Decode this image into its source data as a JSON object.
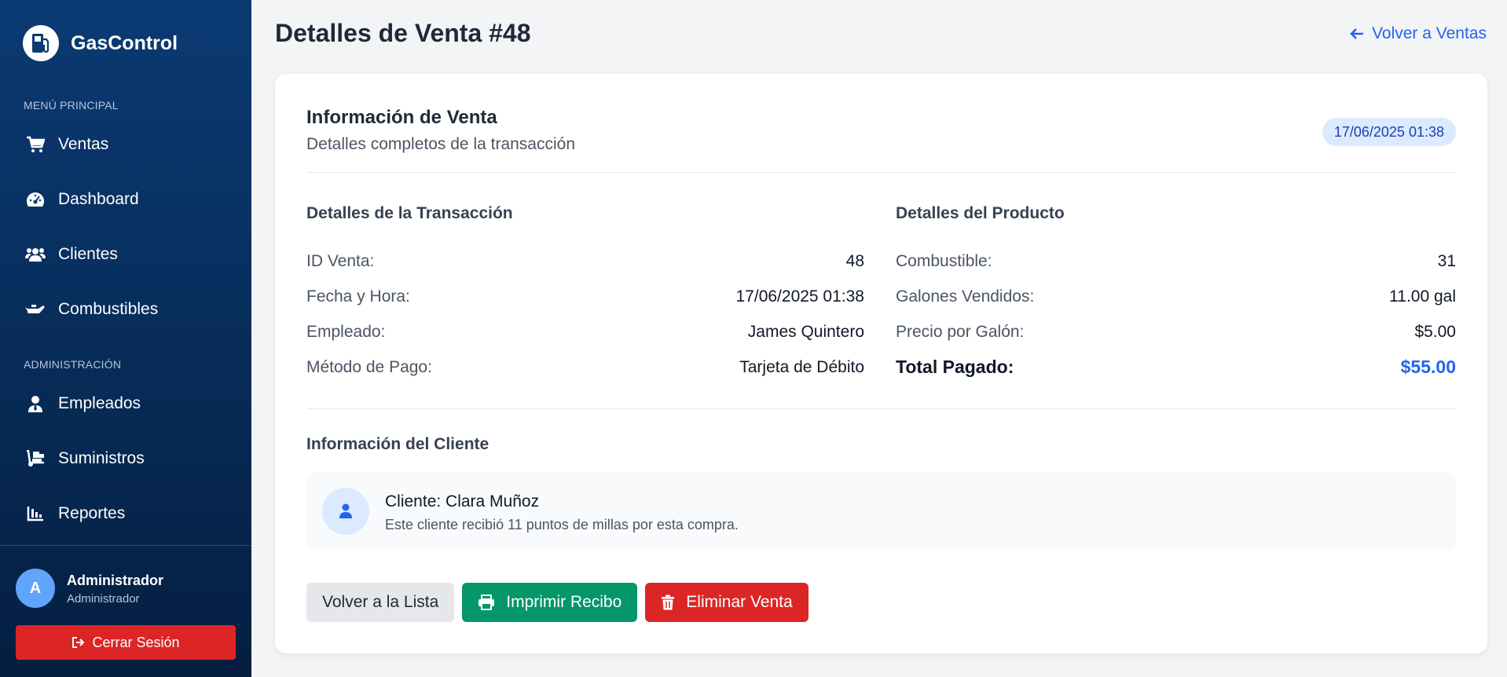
{
  "app": {
    "name": "GasControl"
  },
  "sidebar": {
    "main_menu_label": "MENÚ PRINCIPAL",
    "admin_label": "ADMINISTRACIÓN",
    "main_items": [
      {
        "label": "Ventas",
        "icon": "cart-icon"
      },
      {
        "label": "Dashboard",
        "icon": "gauge-icon"
      },
      {
        "label": "Clientes",
        "icon": "users-icon"
      },
      {
        "label": "Combustibles",
        "icon": "oil-can-icon"
      }
    ],
    "admin_items": [
      {
        "label": "Empleados",
        "icon": "user-tie-icon"
      },
      {
        "label": "Suministros",
        "icon": "truck-loading-icon"
      },
      {
        "label": "Reportes",
        "icon": "chart-bar-icon"
      }
    ],
    "user": {
      "initial": "A",
      "name": "Administrador",
      "role": "Administrador"
    },
    "logout_label": "Cerrar Sesión"
  },
  "header": {
    "title": "Detalles de Venta #48",
    "back_label": "Volver a Ventas"
  },
  "card": {
    "title": "Información de Venta",
    "subtitle": "Detalles completos de la transacción",
    "date_badge": "17/06/2025 01:38",
    "transaction": {
      "heading": "Detalles de la Transacción",
      "rows": [
        {
          "label": "ID Venta:",
          "value": "48"
        },
        {
          "label": "Fecha y Hora:",
          "value": "17/06/2025 01:38"
        },
        {
          "label": "Empleado:",
          "value": "James Quintero"
        },
        {
          "label": "Método de Pago:",
          "value": "Tarjeta de Débito"
        }
      ]
    },
    "product": {
      "heading": "Detalles del Producto",
      "rows": [
        {
          "label": "Combustible:",
          "value": "31"
        },
        {
          "label": "Galones Vendidos:",
          "value": "11.00 gal"
        },
        {
          "label": "Precio por Galón:",
          "value": "$5.00"
        }
      ],
      "total_label": "Total Pagado:",
      "total_value": "$55.00"
    },
    "client": {
      "heading": "Información del Cliente",
      "name": "Cliente: Clara Muñoz",
      "note": "Este cliente recibió 11 puntos de millas por esta compra."
    },
    "actions": {
      "back_list": "Volver a la Lista",
      "print": "Imprimir Recibo",
      "delete": "Eliminar Venta"
    }
  },
  "colors": {
    "sidebar_top": "#0b3a73",
    "sidebar_bottom": "#041e40",
    "accent_blue": "#2563eb",
    "success_green": "#059669",
    "danger_red": "#dc2626",
    "badge_bg": "#dbeafe"
  }
}
